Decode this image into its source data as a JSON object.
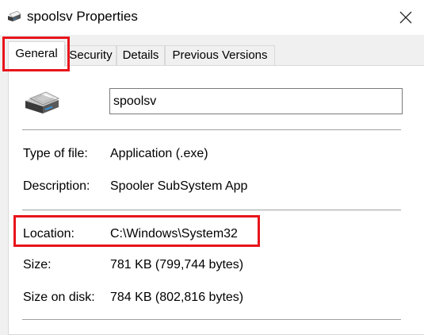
{
  "window": {
    "title": "spoolsv Properties",
    "title_icon": "printer-icon",
    "close_icon": "close-icon"
  },
  "tabs": [
    {
      "label": "General",
      "active": true
    },
    {
      "label": "Security",
      "active": false
    },
    {
      "label": "Details",
      "active": false
    },
    {
      "label": "Previous Versions",
      "active": false
    }
  ],
  "general": {
    "file_name": "spoolsv",
    "file_icon": "printer-icon",
    "type_of_file": {
      "label": "Type of file:",
      "value": "Application (.exe)"
    },
    "description": {
      "label": "Description:",
      "value": "Spooler SubSystem App"
    },
    "location": {
      "label": "Location:",
      "value": "C:\\Windows\\System32"
    },
    "size": {
      "label": "Size:",
      "value": "781 KB (799,744 bytes)"
    },
    "size_on_disk": {
      "label": "Size on disk:",
      "value": "784 KB (802,816 bytes)"
    }
  },
  "colors": {
    "highlight": "#e8141c",
    "panel": "#ffffff",
    "background": "#f0f0f0"
  }
}
